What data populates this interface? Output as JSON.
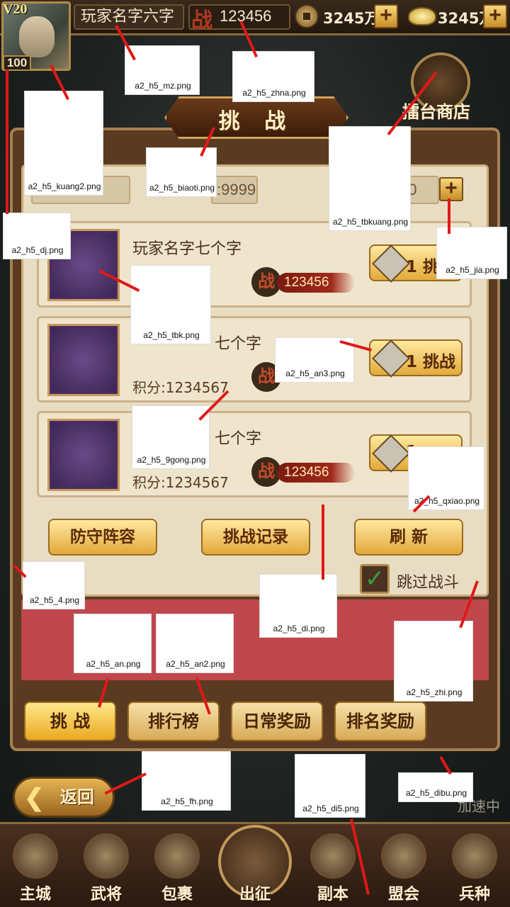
{
  "topbar": {
    "vip": "V20",
    "level": "100",
    "player_name": "玩家名字六字",
    "power_glyph": "战",
    "power": "123456",
    "copper": "3245万",
    "gold": "3245万",
    "plus": "+"
  },
  "shop": {
    "label": "擂台商店"
  },
  "panel": {
    "title": "挑 战",
    "stats": {
      "left": "150",
      "middle": ":9999",
      "right": "00"
    },
    "rows": [
      {
        "name": "玩家名字七个字",
        "score": "7",
        "power": "123456",
        "btn_count": "1",
        "btn_label": "挑"
      },
      {
        "name": "七个字",
        "score": "积分:1234567",
        "power": "",
        "btn_count": "1",
        "btn_label": "挑战"
      },
      {
        "name": "七个字",
        "score": "积分:1234567",
        "power": "123456",
        "btn_count": "1",
        "btn_label": ""
      }
    ],
    "actions": {
      "defense": "防守阵容",
      "record": "挑战记录",
      "refresh": "刷 新"
    },
    "skip": {
      "label": "跳过战斗",
      "checked": true
    }
  },
  "tabs": [
    "挑 战",
    "排行榜",
    "日常奖励",
    "排名奖励"
  ],
  "back": {
    "label": "返回",
    "accel": "加速中"
  },
  "nav": [
    "主城",
    "武将",
    "包裹",
    "出征",
    "副本",
    "盟会",
    "兵种"
  ],
  "annotations": [
    "a2_h5_mz.png",
    "a2_h5_zhna.png",
    "a2_h5_kuang2.png",
    "a2_h5_biaoti.png",
    "a2_h5_tbkuang.png",
    "a2_h5_dj.png",
    "a2_h5_jia.png",
    "a2_h5_tbk.png",
    "a2_h5_an3.png",
    "a2_h5_9gong.png",
    "a2_h5_qxiao.png",
    "a2_h5_4.png",
    "a2_h5_di.png",
    "a2_h5_an.png",
    "a2_h5_an2.png",
    "a2_h5_zhi.png",
    "a2_h5_fh.png",
    "a2_h5_di5.png",
    "a2_h5_dibu.png"
  ],
  "colors": {
    "accent": "#e2aa3a",
    "annotation_line": "#e01818",
    "red_band": "#c0474c"
  }
}
